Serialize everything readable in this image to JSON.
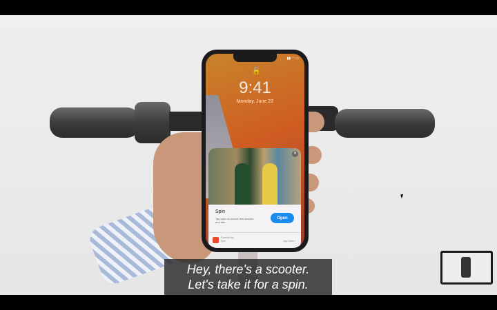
{
  "phone": {
    "time": "9:41",
    "date": "Monday, June 22",
    "notification": {
      "app_name": "Spin",
      "description": "Tap open to unlock this scooter and ride.",
      "button": "Open",
      "powered_by": "Powered by",
      "brand": "Spin",
      "store_link": "App Store ›"
    }
  },
  "subtitles": {
    "line1": "Hey, there's a scooter.",
    "line2": "Let's take it for a spin."
  },
  "colors": {
    "accent": "#1a8cf0",
    "brand": "#e84a2c"
  }
}
